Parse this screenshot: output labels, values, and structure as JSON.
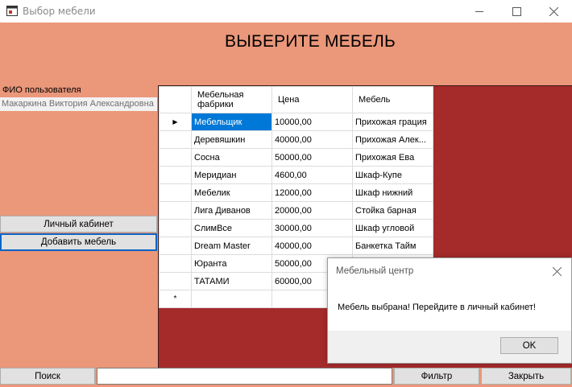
{
  "window": {
    "title": "Выбор мебели",
    "icon": "app-icon"
  },
  "main": {
    "heading": "ВЫБЕРИТЕ МЕБЕЛЬ",
    "user_label": "ФИО пользователя",
    "user_value": "Макаркина Виктория Александровна",
    "cabinet_button": "Личный кабинет",
    "add_button": "Добавить мебель"
  },
  "grid": {
    "columns": [
      "Мебельная фабрики",
      "Цена",
      "Мебель"
    ],
    "rows": [
      {
        "factory": "Мебельщик",
        "price": "10000,00",
        "furniture": "Прихожая грация"
      },
      {
        "factory": "Деревяшкин",
        "price": "40000,00",
        "furniture": "Прихожая Алек..."
      },
      {
        "factory": "Сосна",
        "price": "50000,00",
        "furniture": "Прихожая Ева"
      },
      {
        "factory": "Меридиан",
        "price": "4600,00",
        "furniture": "Шкаф-Купе"
      },
      {
        "factory": "Мебелик",
        "price": "12000,00",
        "furniture": "Шкаф нижний"
      },
      {
        "factory": "Лига Диванов",
        "price": "20000,00",
        "furniture": "Стойка барная"
      },
      {
        "factory": "СлимВсе",
        "price": "30000,00",
        "furniture": "Шкаф угловой"
      },
      {
        "factory": "Dream Master",
        "price": "40000,00",
        "furniture": "Банкетка Тайм"
      },
      {
        "factory": "Юранта",
        "price": "50000,00",
        "furniture": ""
      },
      {
        "factory": "ТАТАМИ",
        "price": "60000,00",
        "furniture": ""
      }
    ],
    "current_row_marker": "▶",
    "new_row_marker": "*"
  },
  "bottom": {
    "search_button": "Поиск",
    "search_value": "",
    "filter_button": "Фильтр",
    "close_button": "Закрыть"
  },
  "dialog": {
    "title": "Мебельный центр",
    "message": "Мебель выбрана! Перейдите в личный кабинет!",
    "ok_button": "OK"
  },
  "colors": {
    "background": "#ea977a",
    "grid_background": "#a52a2a",
    "selection": "#0078d7"
  }
}
